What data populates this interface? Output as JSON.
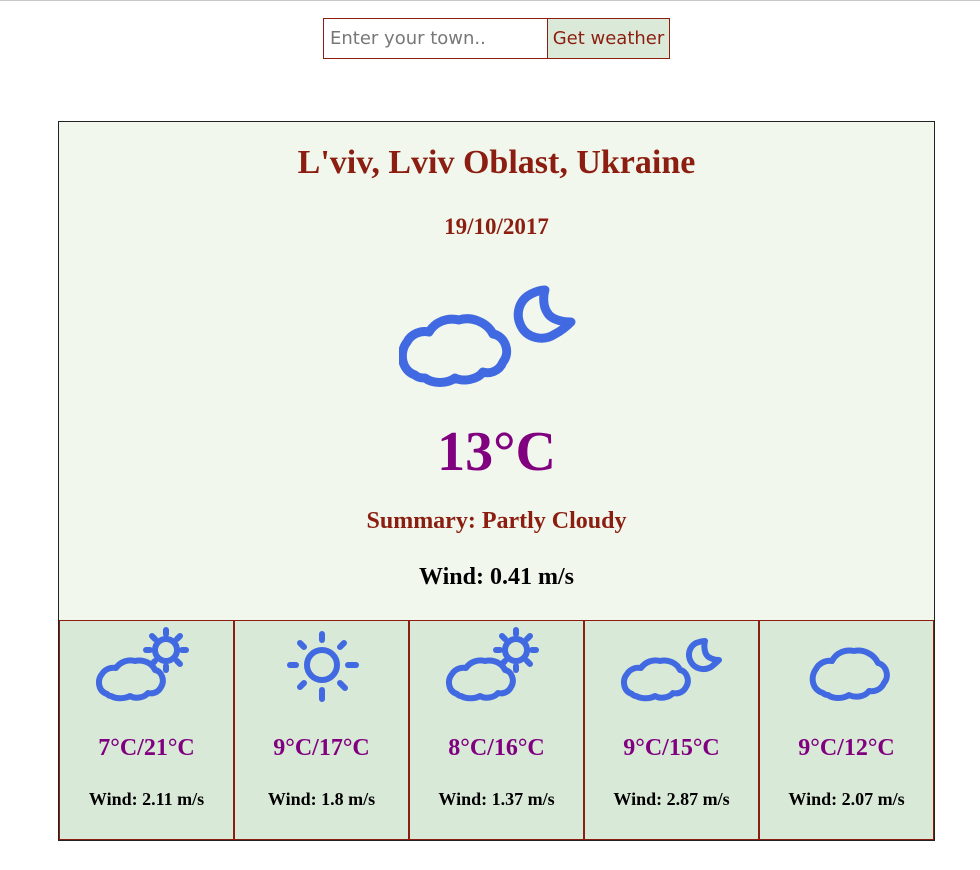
{
  "search": {
    "placeholder": "Enter your town..",
    "button_label": "Get weather"
  },
  "current": {
    "location": "L'viv, Lviv Oblast, Ukraine",
    "date": "19/10/2017",
    "icon": "partly-cloudy-night-icon",
    "temperature": "13°C",
    "summary": "Summary: Partly Cloudy",
    "wind": "Wind: 0.41 m/s"
  },
  "forecast": [
    {
      "icon": "partly-cloudy-day-icon",
      "temps": "7°C/21°C",
      "wind": "Wind: 2.11 m/s"
    },
    {
      "icon": "clear-day-icon",
      "temps": "9°C/17°C",
      "wind": "Wind: 1.8 m/s"
    },
    {
      "icon": "partly-cloudy-day-icon",
      "temps": "8°C/16°C",
      "wind": "Wind: 1.37 m/s"
    },
    {
      "icon": "partly-cloudy-night-icon",
      "temps": "9°C/15°C",
      "wind": "Wind: 2.87 m/s"
    },
    {
      "icon": "cloudy-icon",
      "temps": "9°C/12°C",
      "wind": "Wind: 2.07 m/s"
    }
  ],
  "colors": {
    "accent": "#8b1e10",
    "temperature": "#800080",
    "icon": "#4169e1",
    "panel": "#f1f7ec",
    "forecast_panel": "#d9e9d7"
  }
}
